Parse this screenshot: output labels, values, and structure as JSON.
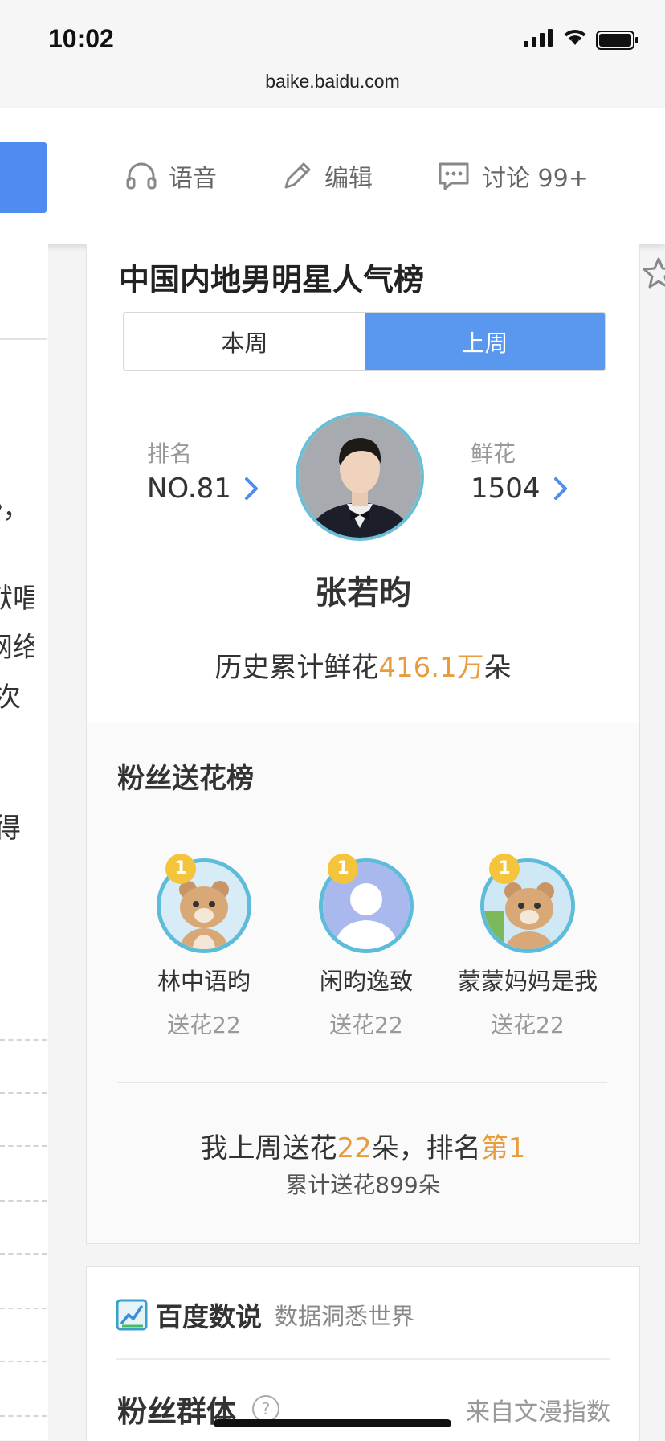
{
  "status_bar": {
    "time": "10:02",
    "url": "baike.baidu.com"
  },
  "toolbar": {
    "voice_label": "语音",
    "edit_label": "编辑",
    "discuss_label": "讨论 99+"
  },
  "left_fragments": [
    "》，",
    "》",
    "献唱",
    "网络",
    "次",
    "得"
  ],
  "ranking": {
    "title": "中国内地男明星人气榜",
    "tabs": [
      "本周",
      "上周"
    ],
    "active_tab": "上周",
    "rank_label": "排名",
    "rank_value": "NO.81",
    "flowers_label": "鲜花",
    "flowers_value": "1504",
    "name": "张若昀",
    "history_prefix": "历史累计鲜花",
    "history_value": "416.1万",
    "history_suffix": "朵"
  },
  "fans": {
    "title": "粉丝送花榜",
    "list": [
      {
        "badge": "1",
        "name": "林中语昀",
        "gift": "送花22"
      },
      {
        "badge": "1",
        "name": "闲昀逸致",
        "gift": "送花22"
      },
      {
        "badge": "1",
        "name": "蒙蒙妈妈是我",
        "gift": "送花22"
      }
    ],
    "my_prefix": "我上周送花",
    "my_count": "22",
    "my_middle": "朵，排名",
    "my_rank": "第1",
    "my_total": "累计送花899朵"
  },
  "shuo": {
    "brand": "百度数说",
    "slogan": "数据洞悉世界",
    "group_title": "粉丝群体",
    "help": "?",
    "source": "来自文漫指数"
  },
  "colors": {
    "accent": "#4e8cf0",
    "highlight": "#e89c3c"
  }
}
